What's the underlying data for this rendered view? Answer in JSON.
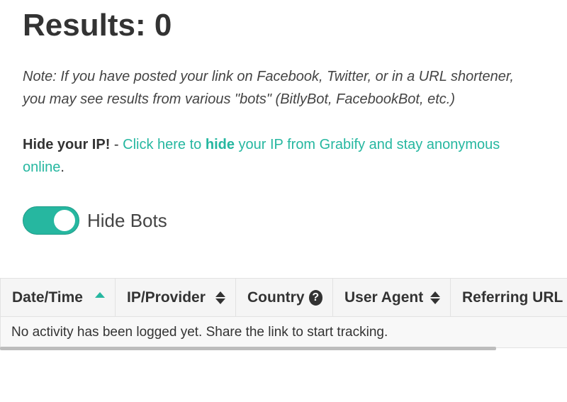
{
  "header": {
    "results_label": "Results: 0"
  },
  "note": "Note: If you have posted your link on Facebook, Twitter, or in a URL shortener, you may see results from various \"bots\" (BitlyBot, FacebookBot, etc.)",
  "hide_ip": {
    "label": "Hide your IP!",
    "separator": " - ",
    "link_pre": "Click here to ",
    "link_bold": "hide",
    "link_post": " your IP from Grabify and stay anonymous online",
    "period": "."
  },
  "toggle": {
    "label": "Hide Bots",
    "state": "on"
  },
  "table": {
    "columns": [
      "Date/Time",
      "IP/Provider",
      "Country",
      "User Agent",
      "Referring URL"
    ],
    "sort_column": "Date/Time",
    "empty_message": "No activity has been logged yet. Share the link to start tracking."
  },
  "colors": {
    "accent": "#26b7a0",
    "text": "#333333"
  },
  "icons": {
    "sort_asc": "sort-up-icon",
    "sort_both": "sort-icon",
    "help": "question-circle-icon"
  }
}
